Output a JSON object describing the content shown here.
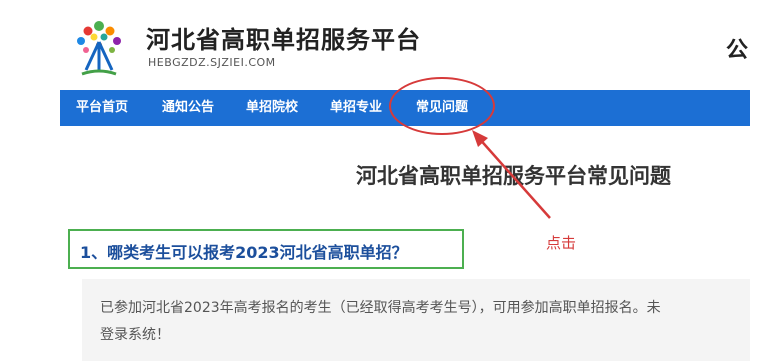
{
  "header": {
    "site_title": "河北省高职单招服务平台",
    "site_url": "HEBGZDZ.SJZIEI.COM",
    "right_text": "公"
  },
  "nav": {
    "items": [
      "平台首页",
      "通知公告",
      "单招院校",
      "单招专业",
      "常见问题"
    ]
  },
  "annotation": {
    "label": "点击",
    "color": "#d63a3a"
  },
  "main": {
    "heading": "河北省高职单招服务平台常见问题",
    "question": "1、哪类考生可以报考2023河北省高职单招？",
    "answer_line1": "已参加河北省2023年高考报名的考生（已经取得高考考生号），可用参加高职单招报名。未",
    "answer_line2": "登录系统！"
  },
  "colors": {
    "nav_bg": "#1c6fd4",
    "question_border": "#4caf50",
    "question_text": "#1c4f9c"
  }
}
